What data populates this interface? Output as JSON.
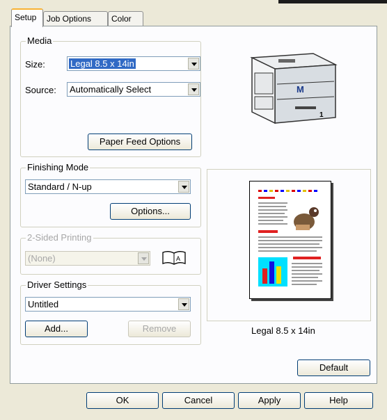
{
  "tabs": [
    {
      "label": "Setup"
    },
    {
      "label": "Job Options"
    },
    {
      "label": "Color"
    }
  ],
  "media": {
    "title": "Media",
    "size_label": "Size:",
    "size_value": "Legal 8.5 x 14in",
    "source_label": "Source:",
    "source_value": "Automatically Select",
    "paper_feed_button": "Paper Feed Options"
  },
  "finishing": {
    "title": "Finishing Mode",
    "value": "Standard / N-up",
    "options_button": "Options..."
  },
  "two_sided": {
    "title": "2-Sided Printing",
    "value": "(None)"
  },
  "driver": {
    "title": "Driver Settings",
    "value": "Untitled",
    "add_button": "Add...",
    "remove_button": "Remove"
  },
  "preview": {
    "caption": "Legal 8.5 x 14in",
    "printer_badge": "M",
    "tray_number": "1"
  },
  "buttons": {
    "default": "Default",
    "ok": "OK",
    "cancel": "Cancel",
    "apply": "Apply",
    "help": "Help"
  },
  "colors": {
    "panel_bg": "#fcfcfe",
    "window_bg": "#ece9d8",
    "selection": "#316ac5",
    "tab_highlight": "#f9b233"
  }
}
